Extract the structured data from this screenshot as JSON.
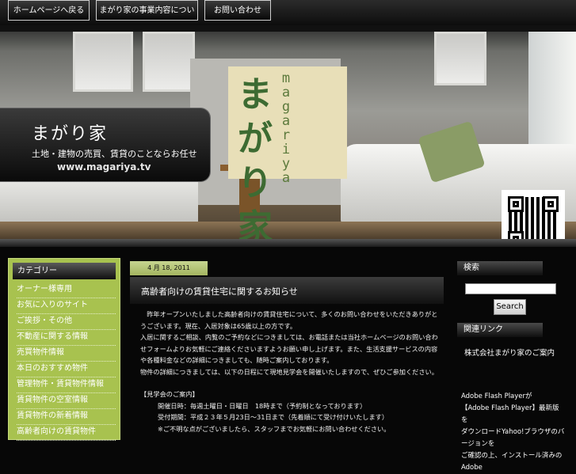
{
  "nav": {
    "tabs": [
      {
        "label": "ホームページへ戻る"
      },
      {
        "label": "まがり家の事業内容について"
      },
      {
        "label": "お問い合わせ"
      }
    ]
  },
  "header": {
    "site_name": "まがり家",
    "site_desc": "土地・建物の売買、賃貸のことならお任せ",
    "site_url": "www.magariya.tv",
    "sign_title": "まがり家",
    "sign_roman": "magariya"
  },
  "left_sidebar": {
    "heading": "カテゴリー",
    "items": [
      "オーナー様専用",
      "お気に入りのサイト",
      "ご挨拶・その他",
      "不動産に関する情報",
      "売買物件情報",
      "本日のおすすめ物件",
      "管理物件・賃貸物件情報",
      "賃貸物件の空室情報",
      "賃貸物件の新着情報",
      "高齢者向けの賃貸物件"
    ]
  },
  "post": {
    "date": "4 月 18, 2011",
    "title": "高齢者向けの賃貸住宅に関するお知らせ",
    "body": [
      "　昨年オープンいたしました高齢者向けの賃貸住宅について、多くのお問い合わせをいただきありがとうございます。現在、入居対象は65歳以上の方です。",
      "入居に関するご相談、内覧のご予約などにつきましては、お電話または当社ホームページのお問い合わせフォームよりお気軽にご連絡くださいますようお願い申し上げます。また、生活支援サービスの内容や各種料金などの詳細につきましても、随時ご案内しております。",
      "物件の詳細につきましては、以下の日程にて現地見学会を開催いたしますので、ぜひご参加ください。"
    ],
    "info_heading": "【見学会のご案内】",
    "info_lines": [
      "開催日時：毎週土曜日・日曜日　18時まで（予約制となっております）",
      "受付期間：平成２３年５月23日～31日まで（先着順にて受け付けいたします）",
      "※ご不明な点がございましたら、スタッフまでお気軽にお問い合わせください。"
    ]
  },
  "right_sidebar": {
    "search_heading": "検索",
    "search_value": "",
    "search_button": "Search",
    "links_heading": "関連リンク",
    "link1": "株式会社まがり家のご案内",
    "flash_lines": [
      "Adobe Flash Playerが",
      "【Adobe Flash Player】最新版を",
      "ダウンロードYahoo!ブラウザのバージョンを",
      "ご確認の上、インストール済みのAdobe"
    ]
  }
}
